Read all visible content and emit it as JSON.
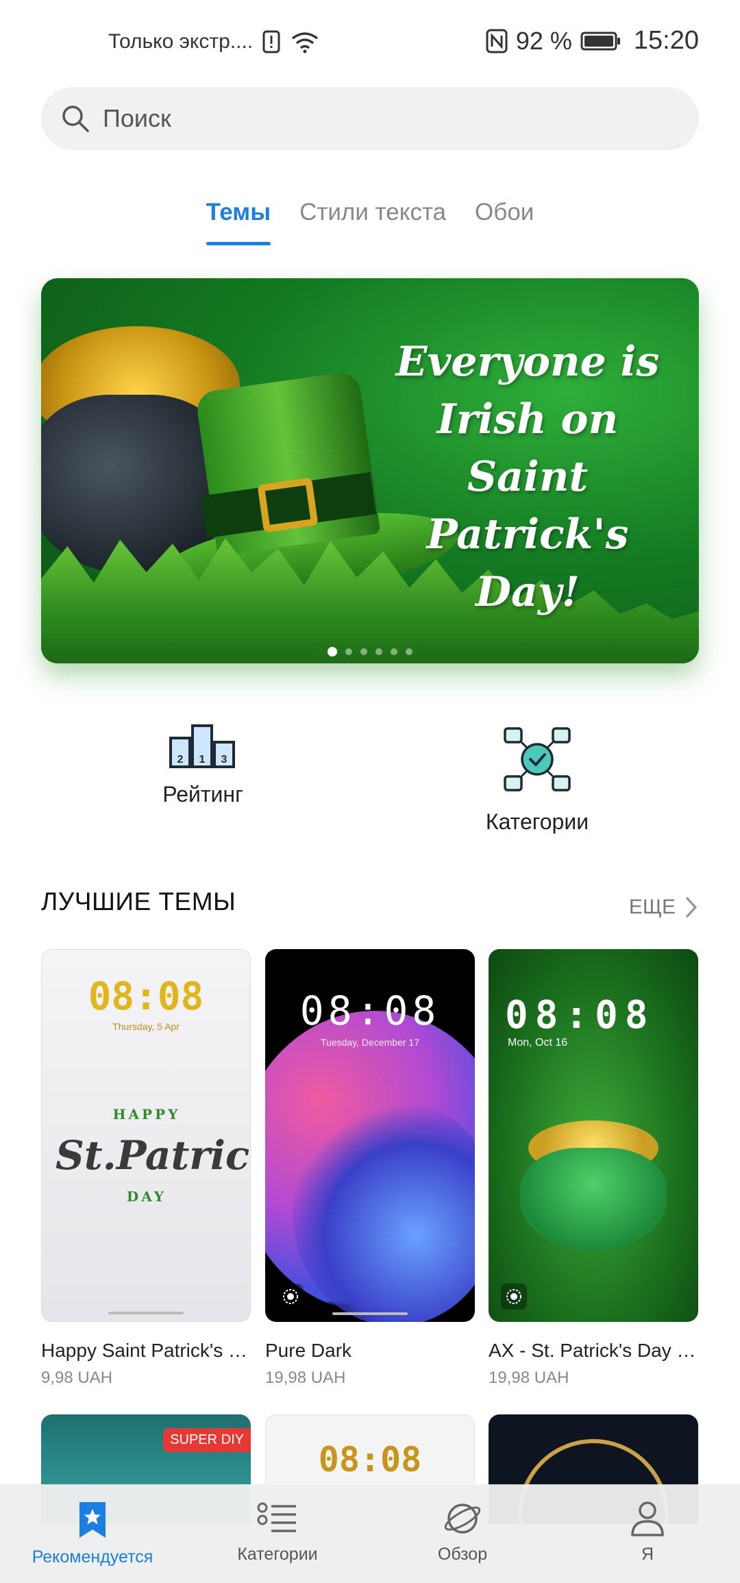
{
  "status_bar": {
    "carrier": "Только экстр....",
    "battery_percent": "92 %",
    "time": "15:20"
  },
  "search": {
    "placeholder": "Поиск"
  },
  "tabs": [
    {
      "label": "Темы",
      "active": true
    },
    {
      "label": "Стили текста",
      "active": false
    },
    {
      "label": "Обои",
      "active": false
    }
  ],
  "banner": {
    "headline": "Everyone is Irish on Saint Patrick's Day!",
    "page_count": 6,
    "active_page": 1
  },
  "shortcuts": [
    {
      "label": "Рейтинг",
      "icon": "podium-icon"
    },
    {
      "label": "Категории",
      "icon": "categories-icon"
    }
  ],
  "section": {
    "title": "ЛУЧШИЕ ТЕМЫ",
    "more_label": "ЕЩЕ"
  },
  "themes": [
    {
      "name": "Happy Saint Patrick's D...",
      "price": "9,98 UAH",
      "preview_time": "08:08",
      "preview_date": "Thursday, 5 Apr",
      "preview_art": "St.Patrick's",
      "preview_art_top": "HAPPY",
      "preview_art_bottom": "DAY"
    },
    {
      "name": "Pure Dark",
      "price": "19,98 UAH",
      "preview_time": "08:08",
      "preview_date": "Tuesday, December 17"
    },
    {
      "name": "AX - St. Patrick's Day -...",
      "price": "19,98 UAH",
      "preview_time": "08:08",
      "preview_date": "Mon, Oct 16"
    }
  ],
  "second_row": {
    "badge": "SUPER DIY",
    "preview_time": "08:08"
  },
  "bottom_nav": [
    {
      "label": "Рекомендуется",
      "icon": "star-bookmark-icon",
      "active": true
    },
    {
      "label": "Категории",
      "icon": "list-icon",
      "active": false
    },
    {
      "label": "Обзор",
      "icon": "planet-icon",
      "active": false
    },
    {
      "label": "Я",
      "icon": "person-icon",
      "active": false
    }
  ],
  "colors": {
    "accent": "#1a7fe0",
    "badge": "#e53935"
  }
}
